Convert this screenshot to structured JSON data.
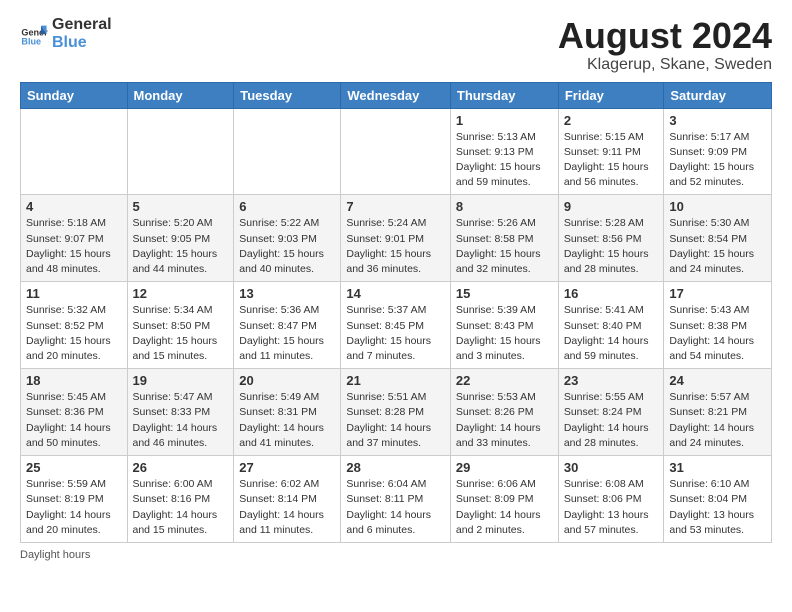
{
  "logo": {
    "general": "General",
    "blue": "Blue"
  },
  "header": {
    "month_year": "August 2024",
    "location": "Klagerup, Skane, Sweden"
  },
  "days_of_week": [
    "Sunday",
    "Monday",
    "Tuesday",
    "Wednesday",
    "Thursday",
    "Friday",
    "Saturday"
  ],
  "weeks": [
    [
      {
        "day": "",
        "info": ""
      },
      {
        "day": "",
        "info": ""
      },
      {
        "day": "",
        "info": ""
      },
      {
        "day": "",
        "info": ""
      },
      {
        "day": "1",
        "info": "Sunrise: 5:13 AM\nSunset: 9:13 PM\nDaylight: 15 hours and 59 minutes."
      },
      {
        "day": "2",
        "info": "Sunrise: 5:15 AM\nSunset: 9:11 PM\nDaylight: 15 hours and 56 minutes."
      },
      {
        "day": "3",
        "info": "Sunrise: 5:17 AM\nSunset: 9:09 PM\nDaylight: 15 hours and 52 minutes."
      }
    ],
    [
      {
        "day": "4",
        "info": "Sunrise: 5:18 AM\nSunset: 9:07 PM\nDaylight: 15 hours and 48 minutes."
      },
      {
        "day": "5",
        "info": "Sunrise: 5:20 AM\nSunset: 9:05 PM\nDaylight: 15 hours and 44 minutes."
      },
      {
        "day": "6",
        "info": "Sunrise: 5:22 AM\nSunset: 9:03 PM\nDaylight: 15 hours and 40 minutes."
      },
      {
        "day": "7",
        "info": "Sunrise: 5:24 AM\nSunset: 9:01 PM\nDaylight: 15 hours and 36 minutes."
      },
      {
        "day": "8",
        "info": "Sunrise: 5:26 AM\nSunset: 8:58 PM\nDaylight: 15 hours and 32 minutes."
      },
      {
        "day": "9",
        "info": "Sunrise: 5:28 AM\nSunset: 8:56 PM\nDaylight: 15 hours and 28 minutes."
      },
      {
        "day": "10",
        "info": "Sunrise: 5:30 AM\nSunset: 8:54 PM\nDaylight: 15 hours and 24 minutes."
      }
    ],
    [
      {
        "day": "11",
        "info": "Sunrise: 5:32 AM\nSunset: 8:52 PM\nDaylight: 15 hours and 20 minutes."
      },
      {
        "day": "12",
        "info": "Sunrise: 5:34 AM\nSunset: 8:50 PM\nDaylight: 15 hours and 15 minutes."
      },
      {
        "day": "13",
        "info": "Sunrise: 5:36 AM\nSunset: 8:47 PM\nDaylight: 15 hours and 11 minutes."
      },
      {
        "day": "14",
        "info": "Sunrise: 5:37 AM\nSunset: 8:45 PM\nDaylight: 15 hours and 7 minutes."
      },
      {
        "day": "15",
        "info": "Sunrise: 5:39 AM\nSunset: 8:43 PM\nDaylight: 15 hours and 3 minutes."
      },
      {
        "day": "16",
        "info": "Sunrise: 5:41 AM\nSunset: 8:40 PM\nDaylight: 14 hours and 59 minutes."
      },
      {
        "day": "17",
        "info": "Sunrise: 5:43 AM\nSunset: 8:38 PM\nDaylight: 14 hours and 54 minutes."
      }
    ],
    [
      {
        "day": "18",
        "info": "Sunrise: 5:45 AM\nSunset: 8:36 PM\nDaylight: 14 hours and 50 minutes."
      },
      {
        "day": "19",
        "info": "Sunrise: 5:47 AM\nSunset: 8:33 PM\nDaylight: 14 hours and 46 minutes."
      },
      {
        "day": "20",
        "info": "Sunrise: 5:49 AM\nSunset: 8:31 PM\nDaylight: 14 hours and 41 minutes."
      },
      {
        "day": "21",
        "info": "Sunrise: 5:51 AM\nSunset: 8:28 PM\nDaylight: 14 hours and 37 minutes."
      },
      {
        "day": "22",
        "info": "Sunrise: 5:53 AM\nSunset: 8:26 PM\nDaylight: 14 hours and 33 minutes."
      },
      {
        "day": "23",
        "info": "Sunrise: 5:55 AM\nSunset: 8:24 PM\nDaylight: 14 hours and 28 minutes."
      },
      {
        "day": "24",
        "info": "Sunrise: 5:57 AM\nSunset: 8:21 PM\nDaylight: 14 hours and 24 minutes."
      }
    ],
    [
      {
        "day": "25",
        "info": "Sunrise: 5:59 AM\nSunset: 8:19 PM\nDaylight: 14 hours and 20 minutes."
      },
      {
        "day": "26",
        "info": "Sunrise: 6:00 AM\nSunset: 8:16 PM\nDaylight: 14 hours and 15 minutes."
      },
      {
        "day": "27",
        "info": "Sunrise: 6:02 AM\nSunset: 8:14 PM\nDaylight: 14 hours and 11 minutes."
      },
      {
        "day": "28",
        "info": "Sunrise: 6:04 AM\nSunset: 8:11 PM\nDaylight: 14 hours and 6 minutes."
      },
      {
        "day": "29",
        "info": "Sunrise: 6:06 AM\nSunset: 8:09 PM\nDaylight: 14 hours and 2 minutes."
      },
      {
        "day": "30",
        "info": "Sunrise: 6:08 AM\nSunset: 8:06 PM\nDaylight: 13 hours and 57 minutes."
      },
      {
        "day": "31",
        "info": "Sunrise: 6:10 AM\nSunset: 8:04 PM\nDaylight: 13 hours and 53 minutes."
      }
    ]
  ],
  "footer": {
    "note": "Daylight hours"
  }
}
